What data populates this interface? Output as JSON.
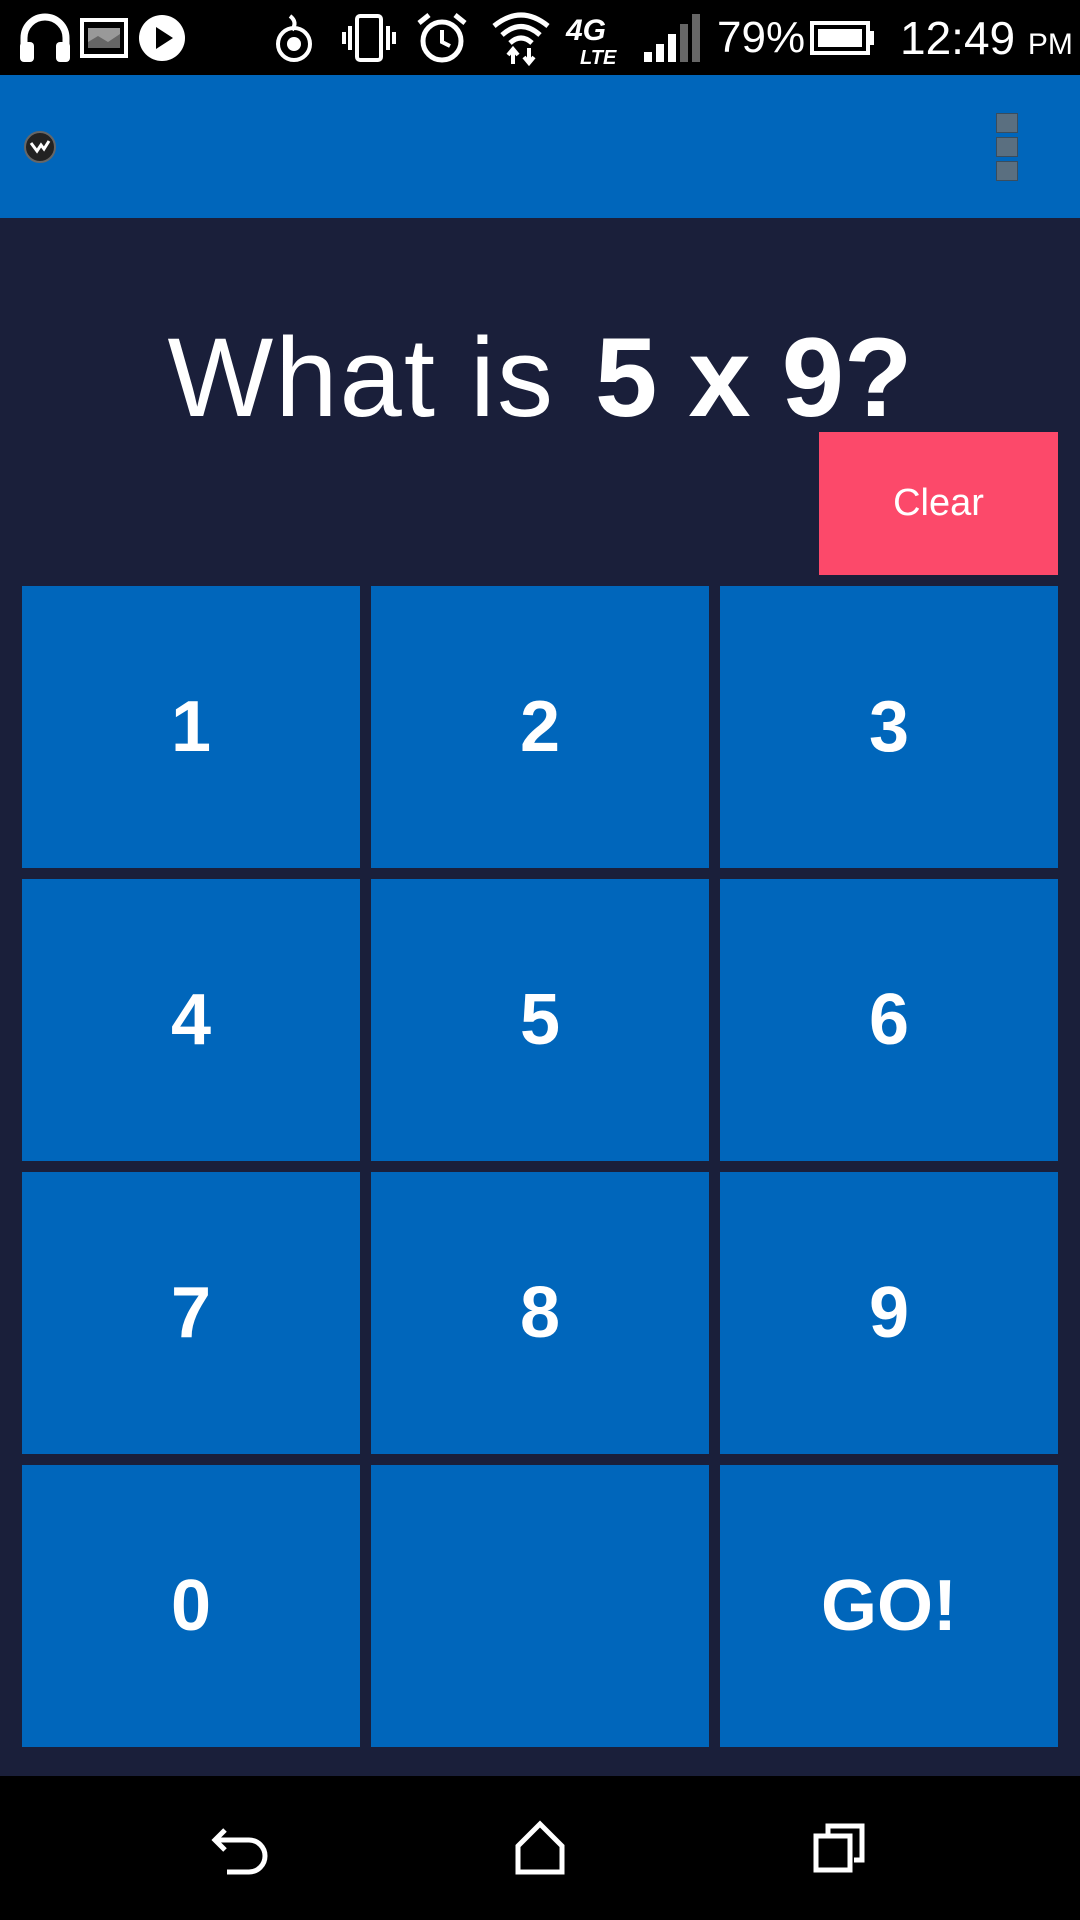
{
  "status_bar": {
    "battery_percent": "79%",
    "time": "12:49",
    "ampm": "PM",
    "network_type": "4G LTE",
    "icons": [
      "headphones-icon",
      "gallery-icon",
      "play-icon",
      "flame-icon",
      "vibrate-icon",
      "alarm-icon",
      "wifi-icon",
      "lte-icon",
      "signal-icon",
      "battery-icon"
    ]
  },
  "app_bar": {
    "logo_icon": "app-logo-icon",
    "menu_icon": "overflow-menu-icon"
  },
  "question": {
    "prefix": "What is",
    "expression": "5 x 9?"
  },
  "clear_button": {
    "label": "Clear",
    "color": "#fc496a"
  },
  "keypad": {
    "keys": [
      "1",
      "2",
      "3",
      "4",
      "5",
      "6",
      "7",
      "8",
      "9",
      "0",
      "",
      "GO!"
    ],
    "key_color": "#0066bb"
  },
  "colors": {
    "background": "#1a1f3a",
    "app_bar": "#0066bb",
    "accent": "#fc496a"
  },
  "nav_bar": {
    "icons": [
      "back-icon",
      "home-icon",
      "recents-icon"
    ]
  }
}
